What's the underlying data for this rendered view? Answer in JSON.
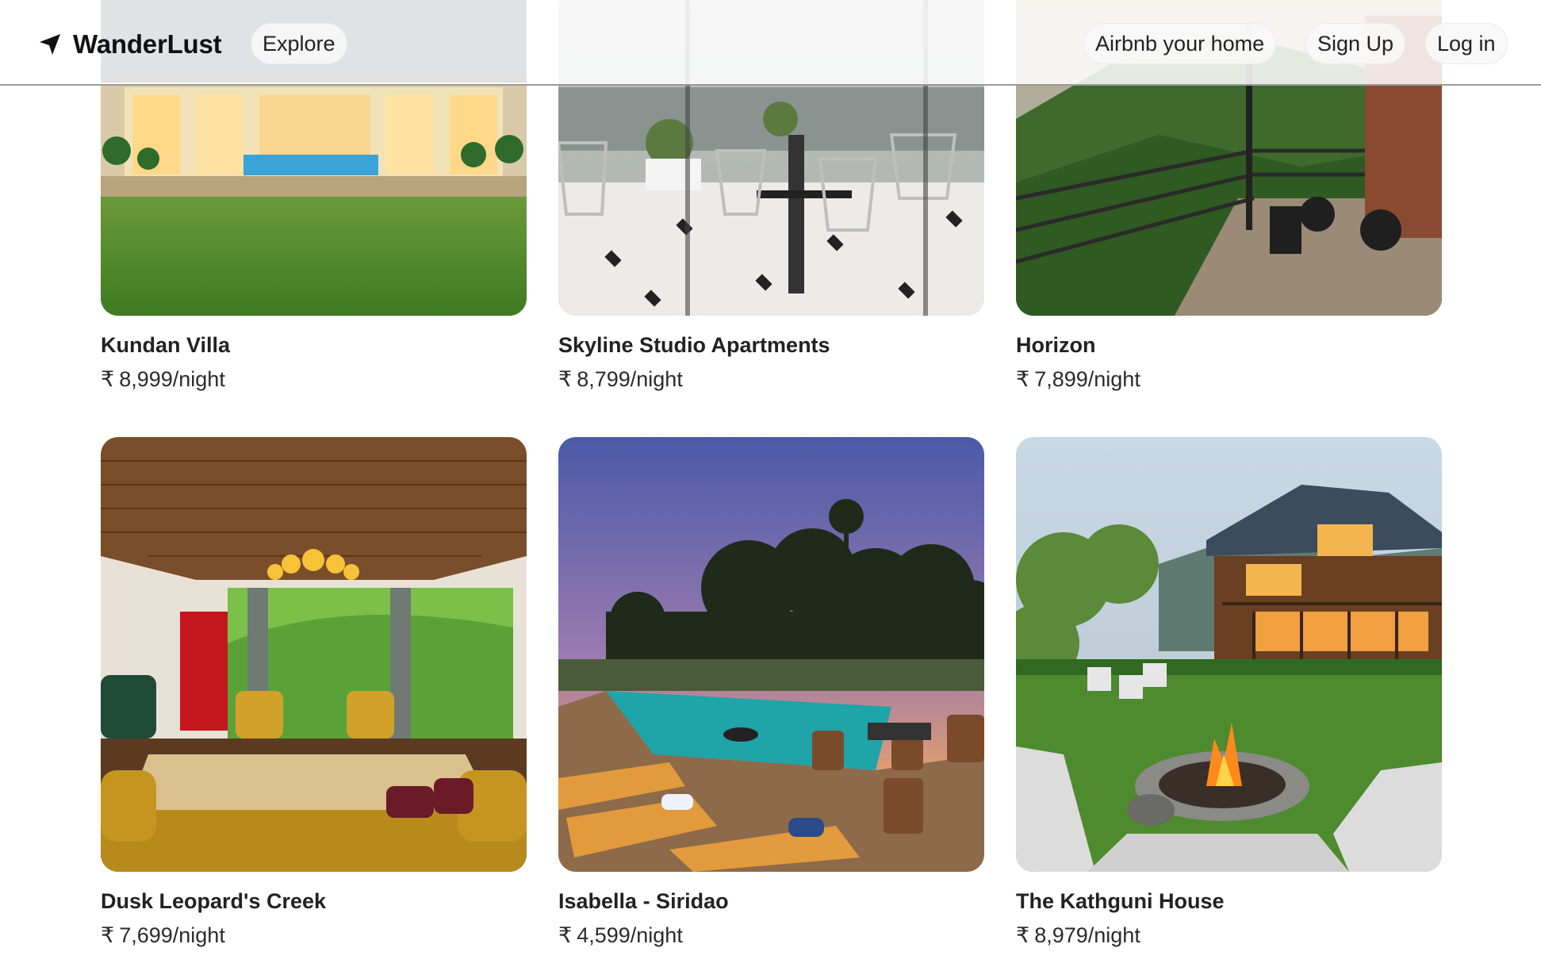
{
  "header": {
    "brand_name": "WanderLust",
    "brand_icon": "navigation-arrow-icon",
    "nav": {
      "explore": "Explore",
      "host": "Airbnb your home",
      "signup": "Sign Up",
      "login": "Log in"
    }
  },
  "listings": [
    {
      "title": "Kundan Villa",
      "currency": "₹",
      "price": "8,999",
      "unit": "/night"
    },
    {
      "title": "Skyline Studio Apartments",
      "currency": "₹",
      "price": "8,799",
      "unit": "/night"
    },
    {
      "title": "Horizon",
      "currency": "₹",
      "price": "7,899",
      "unit": "/night"
    },
    {
      "title": "Dusk Leopard's Creek",
      "currency": "₹",
      "price": "7,699",
      "unit": "/night"
    },
    {
      "title": "Isabella - Siridao",
      "currency": "₹",
      "price": "4,599",
      "unit": "/night"
    },
    {
      "title": "The Kathguni House",
      "currency": "₹",
      "price": "8,979",
      "unit": "/night"
    }
  ]
}
